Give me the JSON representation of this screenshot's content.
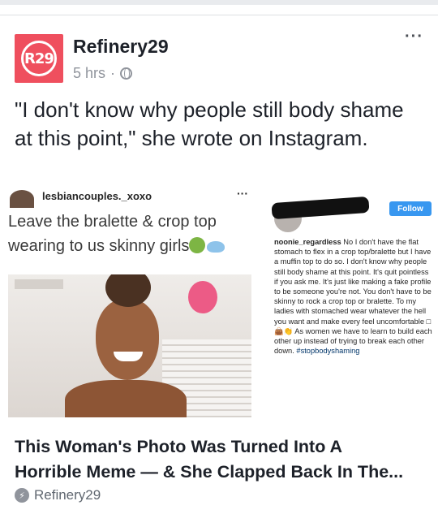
{
  "post": {
    "page_name": "Refinery29",
    "logo_text": "R29",
    "time": "5 hrs",
    "separator": "·",
    "more": "···",
    "status_text": "\"I don't know why people still body shame at this point,\" she wrote on Instagram."
  },
  "image": {
    "meme_user": "lesbiancouples._xoxo",
    "meme_dots": "···",
    "meme_caption": "Leave the bralette & crop top wearing to us skinny girls",
    "follow_label": "Follow",
    "reply_user": "noonie_regardless",
    "reply_text": " No I don't have the flat stomach to flex in a crop top/bralette but I have a muffin top to do so. I don't know why people still body shame at this point. It's quit pointless if you ask me. It's just like making a fake profile to be someone you're not. You don't have to be skinny to rock a crop top or bralette. To my ladies with stomached wear whatever the hell you want and make every feel uncomfortable □👜👏 As women we have to learn to build each other up instead of trying to break each other down. ",
    "reply_hashtag": "#stopbodyshaming"
  },
  "link": {
    "title_line1": "This Woman's Photo Was Turned Into A",
    "title_line2": "Horrible Meme — & She Clapped Back In The...",
    "source": "Refinery29",
    "source_icon": "lightning-bolt-icon"
  },
  "colors": {
    "brand": "#ef4f5e",
    "follow": "#3897f0",
    "meta": "#90949c"
  }
}
